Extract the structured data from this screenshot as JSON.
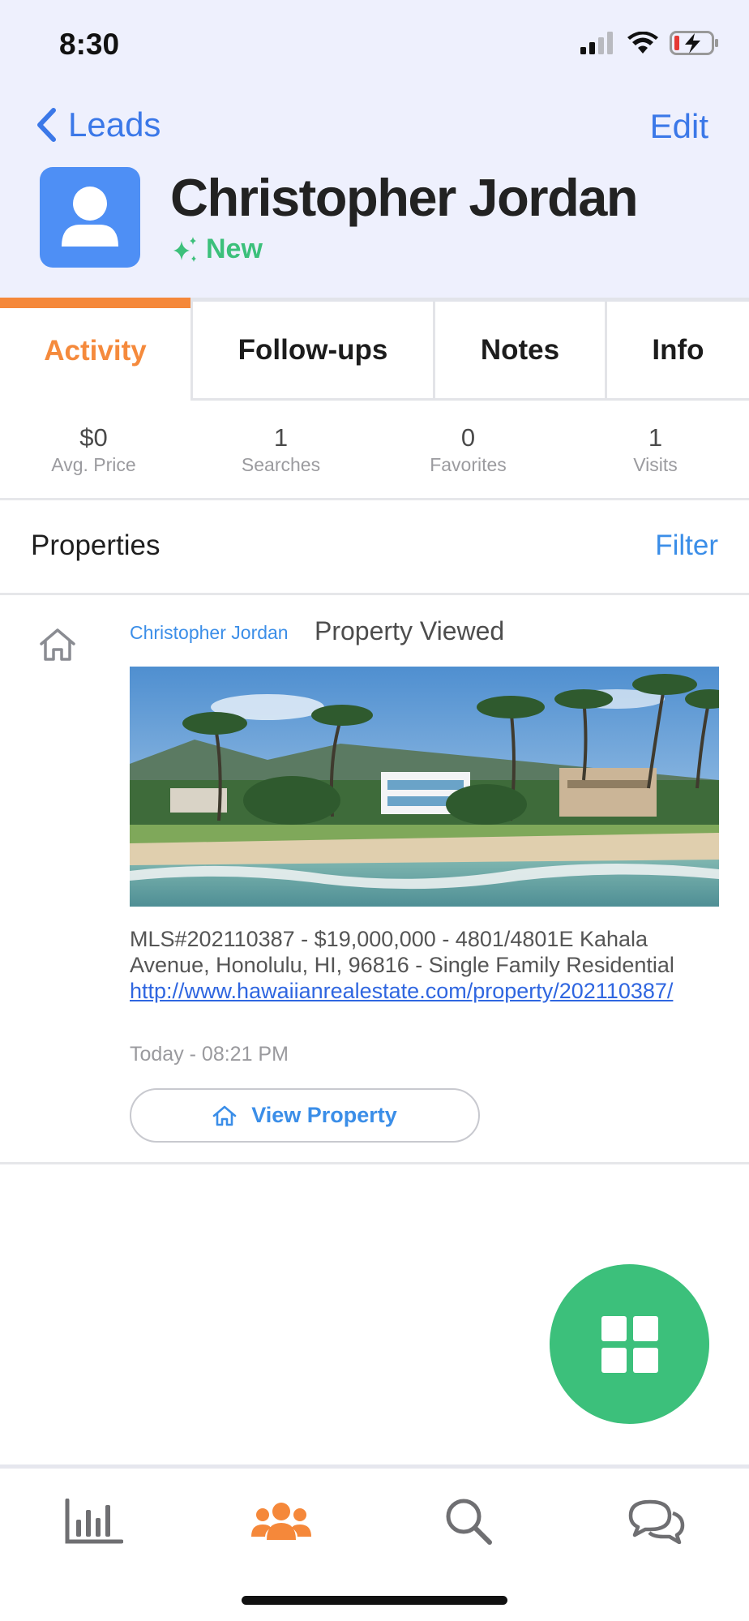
{
  "status_bar": {
    "time": "8:30"
  },
  "nav": {
    "back_label": "Leads",
    "edit_label": "Edit"
  },
  "lead": {
    "name": "Christopher Jordan",
    "status": "New"
  },
  "tabs": [
    {
      "label": "Activity",
      "active": true
    },
    {
      "label": "Follow-ups",
      "active": false
    },
    {
      "label": "Notes",
      "active": false
    },
    {
      "label": "Info",
      "active": false
    }
  ],
  "stats": [
    {
      "value": "$0",
      "label": "Avg. Price"
    },
    {
      "value": "1",
      "label": "Searches"
    },
    {
      "value": "0",
      "label": "Favorites"
    },
    {
      "value": "1",
      "label": "Visits"
    }
  ],
  "section": {
    "title": "Properties",
    "filter_label": "Filter"
  },
  "activity": {
    "actor": "Christopher Jordan",
    "event": "Property Viewed",
    "description": "MLS#202110387 - $19,000,000 - 4801/4801E Kahala Avenue, Honolulu, HI, 96816 - Single Family Residential",
    "link": "http://www.hawaiianrealestate.com/property/202110387/",
    "timestamp": "Today - 08:21 PM",
    "button_label": "View Property"
  },
  "colors": {
    "accent_blue": "#3b8ee8",
    "active_tab_orange": "#f5883a",
    "new_status_green": "#3cc07b",
    "fab_green": "#3cc07b"
  },
  "icons": {
    "back": "chevron-left-icon",
    "avatar": "person-icon",
    "status": "sparkle-icon",
    "activity": "house-icon",
    "fab": "grid-icon",
    "tabbar": [
      "bar-chart-icon",
      "people-icon",
      "search-icon",
      "chat-bubbles-icon"
    ]
  }
}
